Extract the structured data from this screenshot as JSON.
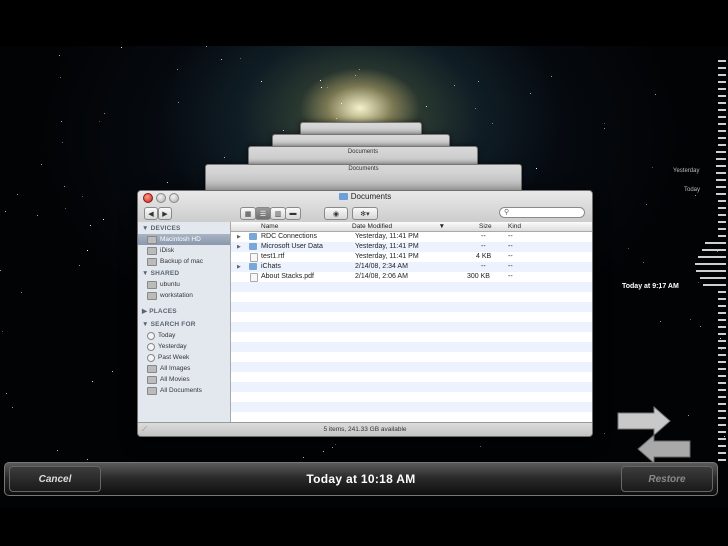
{
  "window": {
    "title": "Documents",
    "search_placeholder": "",
    "status": "5 items, 241.33 GB available"
  },
  "back_window_title": "Documents",
  "sidebar": {
    "devices_header": "DEVICES",
    "devices": [
      "Macintosh HD",
      "iDisk",
      "Backup of mac"
    ],
    "shared_header": "SHARED",
    "shared": [
      "ubuntu",
      "workstation"
    ],
    "places_header": "PLACES",
    "search_header": "SEARCH FOR",
    "search": [
      "Today",
      "Yesterday",
      "Past Week",
      "All Images",
      "All Movies",
      "All Documents"
    ]
  },
  "list": {
    "columns": [
      "Name",
      "Date Modified",
      "Size",
      "Kind"
    ],
    "rows": [
      {
        "name": "RDC Connections",
        "date": "Yesterday, 11:41 PM",
        "size": "--",
        "kind": "--"
      },
      {
        "name": "Microsoft User Data",
        "date": "Yesterday, 11:41 PM",
        "size": "--",
        "kind": "--"
      },
      {
        "name": "test1.rtf",
        "date": "Yesterday, 11:41 PM",
        "size": "4 KB",
        "kind": "--"
      },
      {
        "name": "iChats",
        "date": "2/14/08, 2:34 AM",
        "size": "--",
        "kind": "--"
      },
      {
        "name": "About Stacks.pdf",
        "date": "2/14/08, 2:06 AM",
        "size": "300 KB",
        "kind": "--"
      }
    ]
  },
  "timeline": {
    "yesterday": "Yesterday",
    "today": "Today",
    "current": "Today at 9:17 AM"
  },
  "bottombar": {
    "cancel": "Cancel",
    "title": "Today at 10:18 AM",
    "restore": "Restore"
  }
}
